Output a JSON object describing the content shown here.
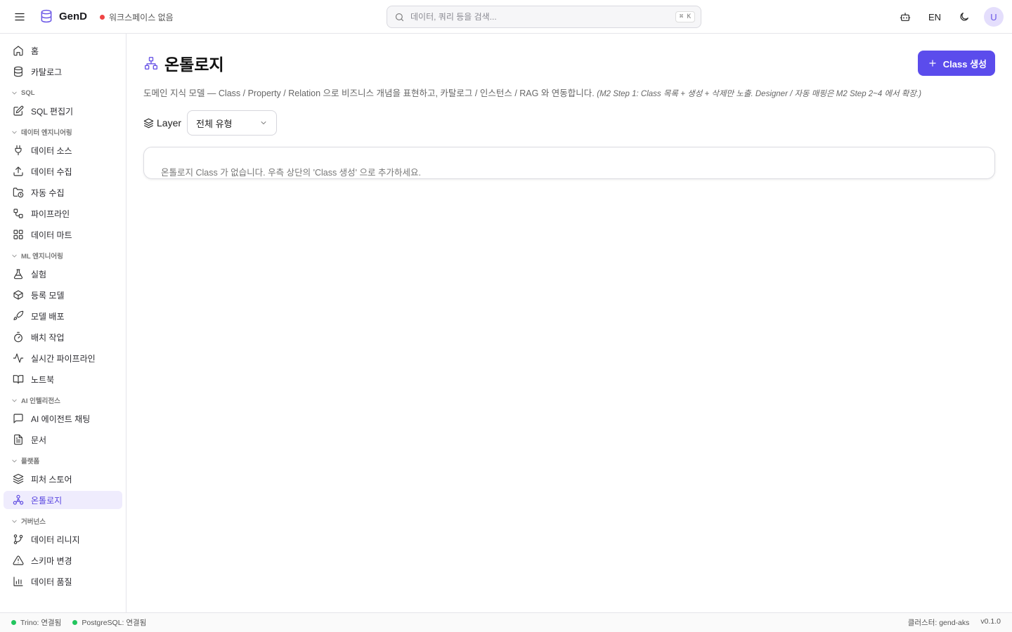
{
  "header": {
    "brand": "GenD",
    "workspace": "워크스페이스 없음",
    "workspace_status_color": "#ef4444",
    "search_placeholder": "데이터, 쿼리 등을 검색...",
    "search_shortcut": "⌘ K",
    "lang": "EN",
    "avatar_initial": "U"
  },
  "sidebar": {
    "top": [
      {
        "label": "홈",
        "icon": "home-icon"
      },
      {
        "label": "카탈로그",
        "icon": "database-icon"
      }
    ],
    "sections": [
      {
        "title": "SQL",
        "items": [
          {
            "label": "SQL 편집기",
            "icon": "edit-icon"
          }
        ]
      },
      {
        "title": "데이터 엔지니어링",
        "items": [
          {
            "label": "데이터 소스",
            "icon": "plug-icon"
          },
          {
            "label": "데이터 수집",
            "icon": "upload-icon"
          },
          {
            "label": "자동 수집",
            "icon": "folder-clock-icon"
          },
          {
            "label": "파이프라인",
            "icon": "workflow-icon"
          },
          {
            "label": "데이터 마트",
            "icon": "grid-icon"
          }
        ]
      },
      {
        "title": "ML 엔지니어링",
        "items": [
          {
            "label": "실험",
            "icon": "flask-icon"
          },
          {
            "label": "등록 모델",
            "icon": "box-icon"
          },
          {
            "label": "모델 배포",
            "icon": "rocket-icon"
          },
          {
            "label": "배치 작업",
            "icon": "timer-icon"
          },
          {
            "label": "실시간 파이프라인",
            "icon": "activity-icon"
          },
          {
            "label": "노트북",
            "icon": "book-icon"
          }
        ]
      },
      {
        "title": "AI 인텔리전스",
        "items": [
          {
            "label": "AI 에이전트 채팅",
            "icon": "chat-icon"
          },
          {
            "label": "문서",
            "icon": "file-text-icon"
          }
        ]
      },
      {
        "title": "플랫폼",
        "items": [
          {
            "label": "피처 스토어",
            "icon": "layers-icon"
          },
          {
            "label": "온톨로지",
            "icon": "ontology-icon",
            "active": true
          }
        ]
      },
      {
        "title": "거버넌스",
        "items": [
          {
            "label": "데이터 리니지",
            "icon": "git-branch-icon"
          },
          {
            "label": "스키마 변경",
            "icon": "alert-triangle-icon"
          },
          {
            "label": "데이터 품질",
            "icon": "bar-chart-icon"
          }
        ]
      }
    ]
  },
  "main": {
    "title": "온톨로지",
    "create_label": "Class 생성",
    "description": "도메인 지식 모델 — Class / Property / Relation 으로 비즈니스 개념을 표현하고, 카탈로그 / 인스턴스 / RAG 와 연동합니다.",
    "description_note": "(M2 Step 1: Class 목록 + 생성 + 삭제만 노출. Designer / 자동 매핑은 M2 Step 2~4 에서 확장.)",
    "layer_label": "Layer",
    "layer_value": "전체 유형",
    "empty_message": "온톨로지 Class 가 없습니다. 우측 상단의 'Class 생성' 으로 추가하세요."
  },
  "footer": {
    "trino": "Trino: 연결됨",
    "postgres": "PostgreSQL: 연결됨",
    "status_color": "#22c55e",
    "cluster": "클러스터: gend-aks",
    "version": "v0.1.0"
  },
  "colors": {
    "accent": "#5b4cec",
    "active_bg": "#efecfd"
  }
}
